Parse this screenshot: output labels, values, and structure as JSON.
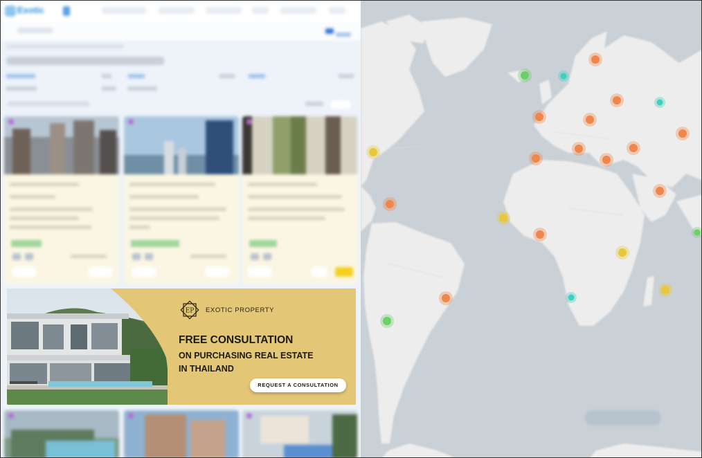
{
  "app": {
    "logo_text": "Exotic"
  },
  "nav": {
    "items": [
      "",
      ""
    ]
  },
  "search": {
    "placeholder": ""
  },
  "listing": {
    "title": "",
    "sort_label": ""
  },
  "ad_banner": {
    "brand": "EXOTIC PROPERTY",
    "logo_letters": "EP",
    "headline": "FREE CONSULTATION",
    "subline_1": "ON PURCHASING REAL ESTATE",
    "subline_2": "IN THAILAND",
    "cta_label": "REQUEST A CONSULTATION",
    "colors": {
      "background": "#e3c676",
      "text": "#1b1a16",
      "button": "#ffffff"
    }
  },
  "map": {
    "cluster_colors": {
      "orange": "#f0874a",
      "yellow": "#e8c83a",
      "green": "#6ccf6a",
      "teal": "#3fd0bf"
    }
  }
}
